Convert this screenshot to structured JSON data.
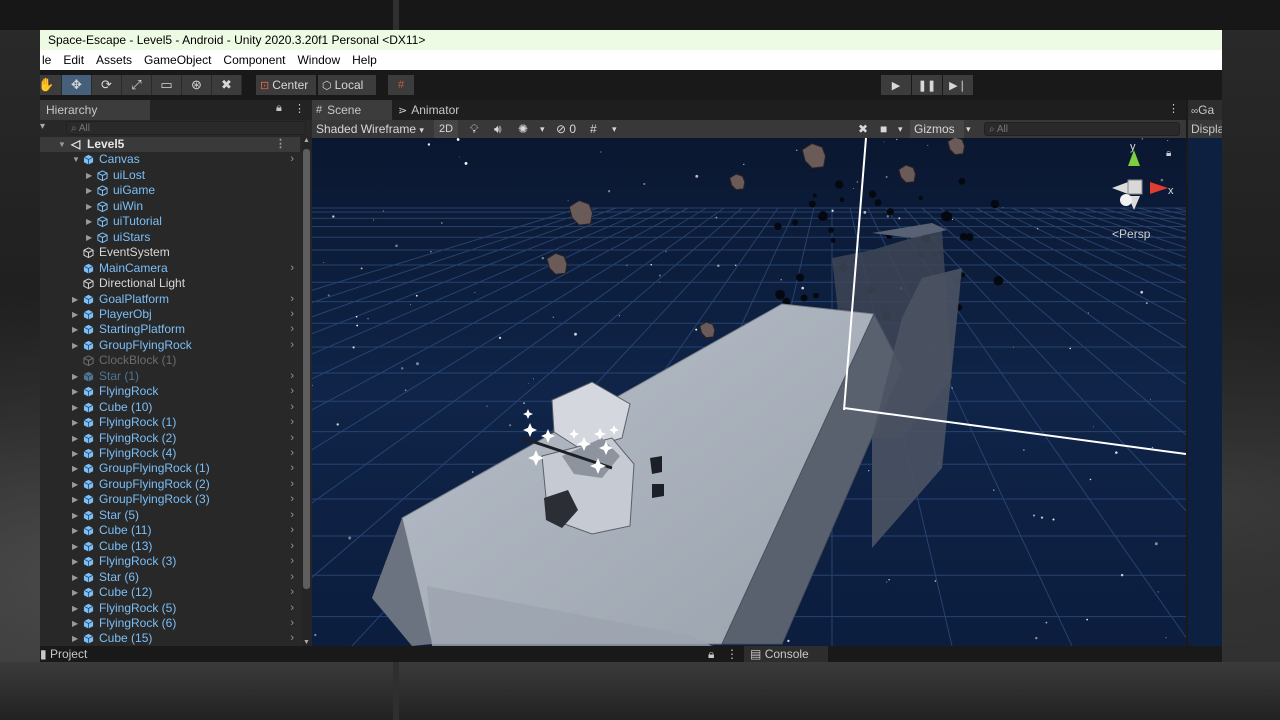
{
  "window": {
    "title": "Space-Escape - Level5 - Android - Unity 2020.3.20f1 Personal <DX11>"
  },
  "menu": [
    "le",
    "Edit",
    "Assets",
    "GameObject",
    "Component",
    "Window",
    "Help"
  ],
  "toolbar": {
    "tools": [
      "hand-tool",
      "move-tool",
      "rotate-tool",
      "scale-tool",
      "rect-tool",
      "transform-tool",
      "custom-tool"
    ],
    "active_tool": "move-tool",
    "pivot_label": "Center",
    "space_label": "Local",
    "play_buttons": [
      "play",
      "pause",
      "step"
    ]
  },
  "hierarchy": {
    "tab_label": "Hierarchy",
    "search_placeholder": "All",
    "scene_name": "Level5",
    "items": [
      {
        "label": "Canvas",
        "depth": 1,
        "style": "blue",
        "expanded": true,
        "chevron": true
      },
      {
        "label": "uiLost",
        "depth": 2,
        "style": "blue",
        "arrow": true
      },
      {
        "label": "uiGame",
        "depth": 2,
        "style": "blue",
        "arrow": true
      },
      {
        "label": "uiWin",
        "depth": 2,
        "style": "blue",
        "arrow": true
      },
      {
        "label": "uiTutorial",
        "depth": 2,
        "style": "blue",
        "arrow": true
      },
      {
        "label": "uiStars",
        "depth": 2,
        "style": "blue",
        "arrow": true
      },
      {
        "label": "EventSystem",
        "depth": 1,
        "style": "white"
      },
      {
        "label": "MainCamera",
        "depth": 1,
        "style": "blue",
        "chevron": true
      },
      {
        "label": "Directional Light",
        "depth": 1,
        "style": "white"
      },
      {
        "label": "GoalPlatform",
        "depth": 1,
        "style": "blue",
        "arrow": true,
        "chevron": true
      },
      {
        "label": "PlayerObj",
        "depth": 1,
        "style": "blue",
        "arrow": true,
        "chevron": true
      },
      {
        "label": "StartingPlatform",
        "depth": 1,
        "style": "blue",
        "arrow": true,
        "chevron": true
      },
      {
        "label": "GroupFlyingRock",
        "depth": 1,
        "style": "blue",
        "arrow": true,
        "chevron": true
      },
      {
        "label": "ClockBlock (1)",
        "depth": 1,
        "style": "dim"
      },
      {
        "label": "Star (1)",
        "depth": 1,
        "style": "dimblue",
        "arrow": true,
        "chevron": true
      },
      {
        "label": "FlyingRock",
        "depth": 1,
        "style": "blue",
        "arrow": true,
        "chevron": true
      },
      {
        "label": "Cube (10)",
        "depth": 1,
        "style": "blue",
        "arrow": true,
        "chevron": true
      },
      {
        "label": "FlyingRock (1)",
        "depth": 1,
        "style": "blue",
        "arrow": true,
        "chevron": true
      },
      {
        "label": "FlyingRock (2)",
        "depth": 1,
        "style": "blue",
        "arrow": true,
        "chevron": true
      },
      {
        "label": "FlyingRock (4)",
        "depth": 1,
        "style": "blue",
        "arrow": true,
        "chevron": true
      },
      {
        "label": "GroupFlyingRock (1)",
        "depth": 1,
        "style": "blue",
        "arrow": true,
        "chevron": true
      },
      {
        "label": "GroupFlyingRock (2)",
        "depth": 1,
        "style": "blue",
        "arrow": true,
        "chevron": true
      },
      {
        "label": "GroupFlyingRock (3)",
        "depth": 1,
        "style": "blue",
        "arrow": true,
        "chevron": true
      },
      {
        "label": "Star (5)",
        "depth": 1,
        "style": "blue",
        "arrow": true,
        "chevron": true
      },
      {
        "label": "Cube (11)",
        "depth": 1,
        "style": "blue",
        "arrow": true,
        "chevron": true
      },
      {
        "label": "Cube (13)",
        "depth": 1,
        "style": "blue",
        "arrow": true,
        "chevron": true
      },
      {
        "label": "FlyingRock (3)",
        "depth": 1,
        "style": "blue",
        "arrow": true,
        "chevron": true
      },
      {
        "label": "Star (6)",
        "depth": 1,
        "style": "blue",
        "arrow": true,
        "chevron": true
      },
      {
        "label": "Cube (12)",
        "depth": 1,
        "style": "blue",
        "arrow": true,
        "chevron": true
      },
      {
        "label": "FlyingRock (5)",
        "depth": 1,
        "style": "blue",
        "arrow": true,
        "chevron": true
      },
      {
        "label": "FlyingRock (6)",
        "depth": 1,
        "style": "blue",
        "arrow": true,
        "chevron": true
      },
      {
        "label": "Cube (15)",
        "depth": 1,
        "style": "blue",
        "arrow": true,
        "chevron": true
      }
    ]
  },
  "scene_view": {
    "tabs": [
      "Scene",
      "Animator"
    ],
    "draw_mode": "Shaded Wireframe",
    "mode_2d": "2D",
    "hidden_count": "0",
    "gizmos_label": "Gizmos",
    "search_placeholder": "All",
    "orientation": {
      "y": "y",
      "x": "x",
      "projection": "Persp"
    }
  },
  "game_view": {
    "tab_label": "Ga",
    "display_label": "Displa"
  },
  "bottom": {
    "project_label": "Project",
    "console_label": "Console"
  },
  "colors": {
    "title_bar": "#edfbe4",
    "selected_text": "#7cbff7",
    "viewport_sky": "#0b1a34"
  }
}
